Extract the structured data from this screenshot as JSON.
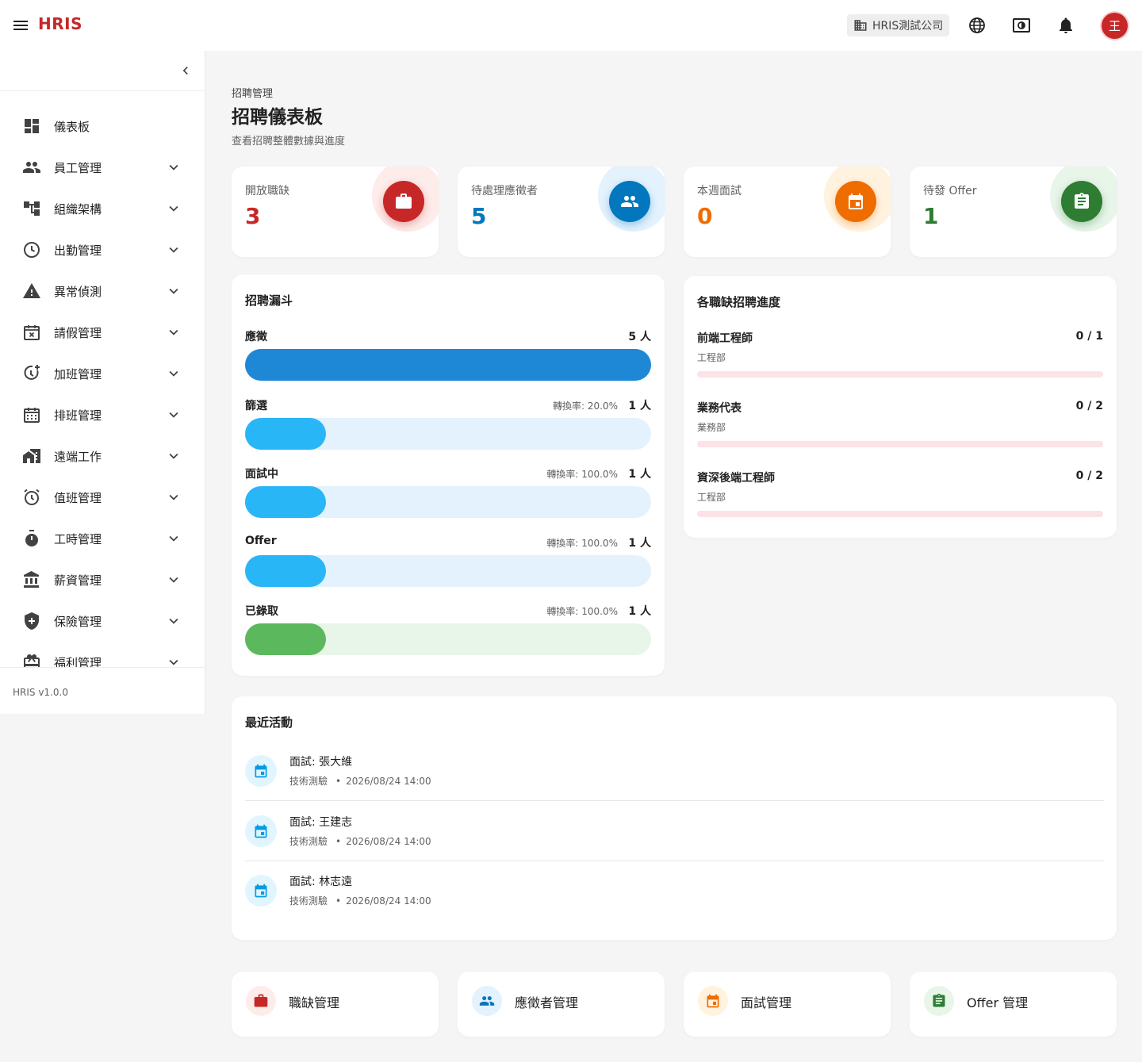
{
  "header": {
    "brand": "HRIS",
    "company": "HRIS測試公司",
    "avatar_initial": "王"
  },
  "sidebar": {
    "items": [
      {
        "label": "儀表板",
        "icon": "dashboard-icon",
        "expandable": false
      },
      {
        "label": "員工管理",
        "icon": "people-icon",
        "expandable": true
      },
      {
        "label": "組織架構",
        "icon": "org-chart-icon",
        "expandable": true
      },
      {
        "label": "出勤管理",
        "icon": "clock-icon",
        "expandable": true
      },
      {
        "label": "異常偵測",
        "icon": "warning-icon",
        "expandable": true
      },
      {
        "label": "請假管理",
        "icon": "calendar-x-icon",
        "expandable": true
      },
      {
        "label": "加班管理",
        "icon": "clock-plus-icon",
        "expandable": true
      },
      {
        "label": "排班管理",
        "icon": "calendar-grid-icon",
        "expandable": true
      },
      {
        "label": "遠端工作",
        "icon": "home-work-icon",
        "expandable": true
      },
      {
        "label": "值班管理",
        "icon": "alarm-icon",
        "expandable": true
      },
      {
        "label": "工時管理",
        "icon": "timer-icon",
        "expandable": true
      },
      {
        "label": "薪資管理",
        "icon": "bank-icon",
        "expandable": true
      },
      {
        "label": "保險管理",
        "icon": "shield-icon",
        "expandable": true
      },
      {
        "label": "福利管理",
        "icon": "gift-icon",
        "expandable": true
      }
    ],
    "version": "HRIS v1.0.0"
  },
  "page": {
    "breadcrumb": "招聘管理",
    "title": "招聘儀表板",
    "subtitle": "查看招聘整體數據與進度"
  },
  "stats": [
    {
      "label": "開放職缺",
      "value": "3",
      "color": "#c62828",
      "bg": "#fdecea",
      "icon": "briefcase-icon"
    },
    {
      "label": "待處理應徵者",
      "value": "5",
      "color": "#0277bd",
      "bg": "#e3f2fd",
      "icon": "people-icon"
    },
    {
      "label": "本週面試",
      "value": "0",
      "color": "#ef6c00",
      "bg": "#fff3e0",
      "icon": "calendar-icon"
    },
    {
      "label": "待發 Offer",
      "value": "1",
      "color": "#2e7d32",
      "bg": "#e8f5e9",
      "icon": "clipboard-icon"
    }
  ],
  "funnel": {
    "title": "招聘漏斗",
    "stages": [
      {
        "label": "應徵",
        "count": "5 人",
        "rate": "",
        "fraction": 1.0,
        "fill": "#1e88d6",
        "track": "#e3f2fd"
      },
      {
        "label": "篩選",
        "count": "1 人",
        "rate": "轉換率: 20.0%",
        "fraction": 0.2,
        "fill": "#29b6f6",
        "track": "#e3f2fd"
      },
      {
        "label": "面試中",
        "count": "1 人",
        "rate": "轉換率: 100.0%",
        "fraction": 0.2,
        "fill": "#29b6f6",
        "track": "#e3f2fd"
      },
      {
        "label": "Offer",
        "count": "1 人",
        "rate": "轉換率: 100.0%",
        "fraction": 0.2,
        "fill": "#29b6f6",
        "track": "#e3f2fd"
      },
      {
        "label": "已錄取",
        "count": "1 人",
        "rate": "轉換率: 100.0%",
        "fraction": 0.2,
        "fill": "#5cb85c",
        "track": "#e8f5e9"
      }
    ]
  },
  "progress": {
    "title": "各職缺招聘進度",
    "jobs": [
      {
        "title": "前端工程師",
        "dept": "工程部",
        "ratio": "0 / 1",
        "fraction": 0
      },
      {
        "title": "業務代表",
        "dept": "業務部",
        "ratio": "0 / 2",
        "fraction": 0
      },
      {
        "title": "資深後端工程師",
        "dept": "工程部",
        "ratio": "0 / 2",
        "fraction": 0
      }
    ]
  },
  "activity": {
    "title": "最近活動",
    "items": [
      {
        "title": "面試: 張大維",
        "type": "技術測驗",
        "time": "2026/08/24 14:00"
      },
      {
        "title": "面試: 王建志",
        "type": "技術測驗",
        "time": "2026/08/24 14:00"
      },
      {
        "title": "面試: 林志遠",
        "type": "技術測驗",
        "time": "2026/08/24 14:00"
      }
    ]
  },
  "quick_links": [
    {
      "label": "職缺管理",
      "icon": "briefcase-icon",
      "color": "#c62828",
      "bg": "#fdecea"
    },
    {
      "label": "應徵者管理",
      "icon": "people-icon",
      "color": "#0277bd",
      "bg": "#e3f2fd"
    },
    {
      "label": "面試管理",
      "icon": "calendar-icon",
      "color": "#ef6c00",
      "bg": "#fff3e0"
    },
    {
      "label": "Offer 管理",
      "icon": "clipboard-icon",
      "color": "#2e7d32",
      "bg": "#e8f5e9"
    }
  ]
}
